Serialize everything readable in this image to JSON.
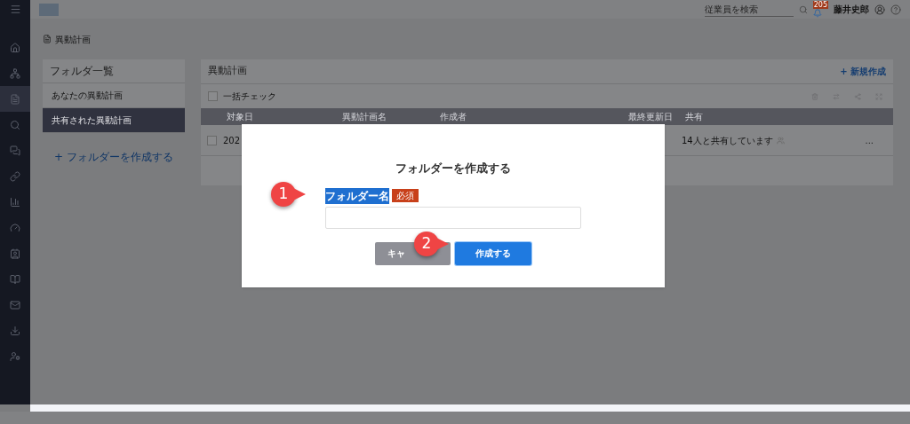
{
  "header": {
    "search": {
      "placeholder": "従業員を検索"
    },
    "notification_count": "205",
    "user_name": "藤井史郎"
  },
  "page_title": "異動計画",
  "folders": {
    "title": "フォルダ一覧",
    "items": [
      {
        "label": "あなたの異動計画",
        "selected": false
      },
      {
        "label": "共有された異動計画",
        "selected": true
      }
    ],
    "create_link": "+ フォルダーを作成する"
  },
  "main": {
    "title": "異動計画",
    "new_link": "+ 新規作成",
    "bulk_check": {
      "label": "一括チェック",
      "checked": false
    },
    "columns": [
      "対象日",
      "異動計画名",
      "作成者",
      "最終更新日",
      "共有"
    ],
    "rows": [
      {
        "checked": false,
        "cells": [
          "202",
          "",
          "",
          "",
          "14人と共有しています"
        ],
        "menu": "..."
      }
    ]
  },
  "dialog": {
    "title": "フォルダーを作成する",
    "field_label": "フォルダー名",
    "required_badge": "必須",
    "cancel_button": "キャ",
    "submit_button": "作成する"
  },
  "annotations": [
    "1",
    "2"
  ]
}
